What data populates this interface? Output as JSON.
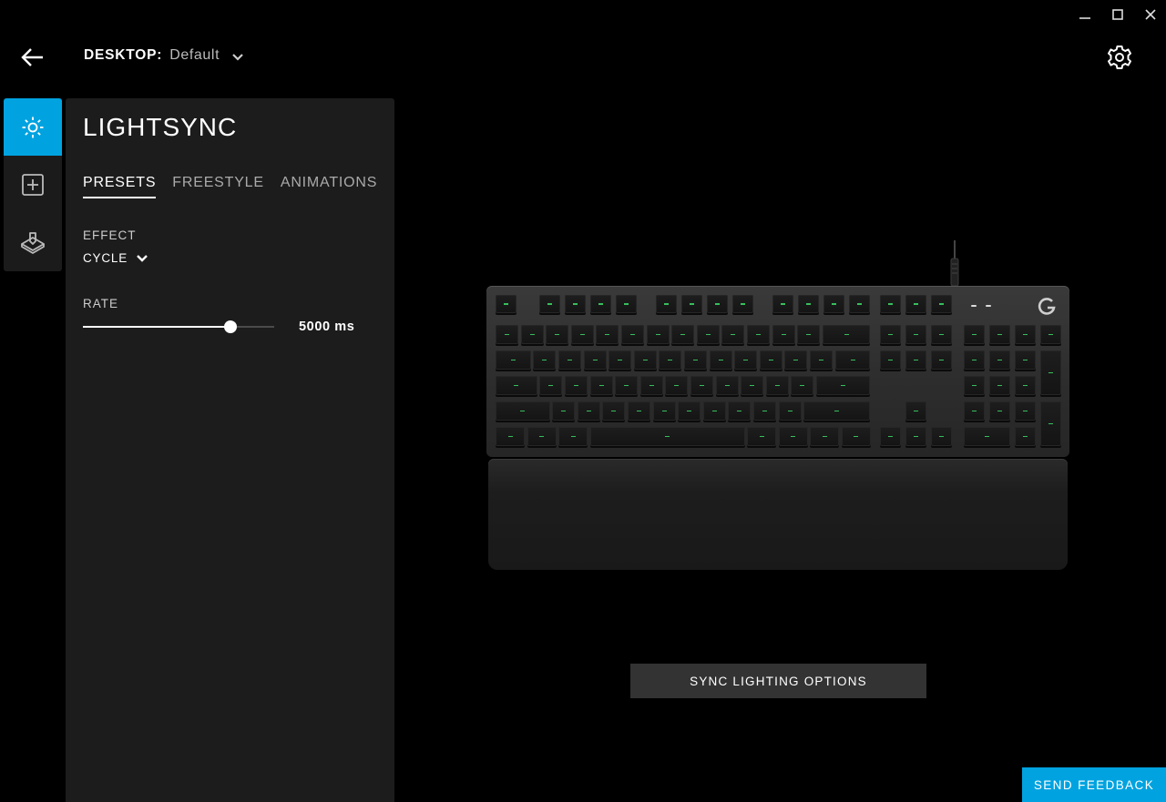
{
  "window": {
    "controls": [
      "minimize-icon",
      "maximize-icon",
      "close-icon"
    ]
  },
  "header": {
    "back_icon": "arrow-left-icon",
    "profile_label": "DESKTOP:",
    "profile_value": "Default",
    "settings_icon": "gear-icon"
  },
  "rail": {
    "items": [
      {
        "icon": "lightsync-icon",
        "active": true
      },
      {
        "icon": "add-icon",
        "active": false
      },
      {
        "icon": "assignments-icon",
        "active": false
      }
    ]
  },
  "panel": {
    "title": "LIGHTSYNC",
    "tabs": [
      {
        "label": "PRESETS",
        "active": true
      },
      {
        "label": "FREESTYLE",
        "active": false
      },
      {
        "label": "ANIMATIONS",
        "active": false
      }
    ],
    "effect_label": "EFFECT",
    "effect_value": "CYCLE",
    "rate_label": "RATE",
    "rate_value": "5000 ms",
    "rate_fraction": 0.77
  },
  "main": {
    "sync_button": "SYNC LIGHTING OPTIONS",
    "feedback_button": "SEND FEEDBACK"
  },
  "colors": {
    "accent": "#00a3e0",
    "key_glow": "#3ddc6a",
    "panel_bg": "#1c1c1c"
  }
}
